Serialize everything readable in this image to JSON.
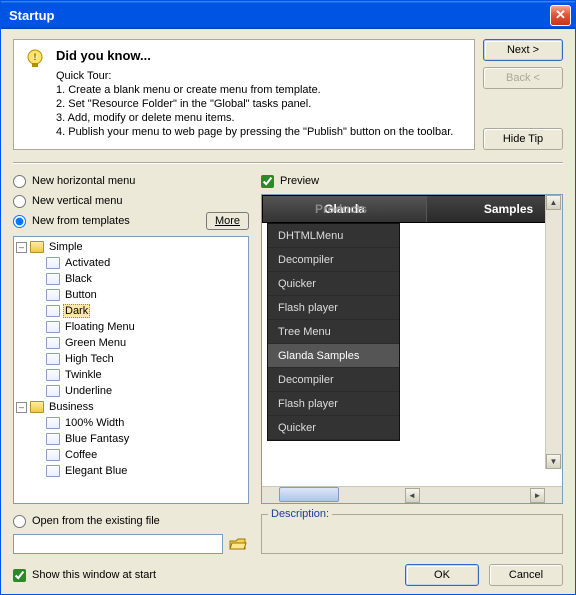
{
  "window": {
    "title": "Startup"
  },
  "tip": {
    "title": "Did you know...",
    "lines": [
      "Quick Tour:",
      "1. Create a blank menu or create menu from template.",
      "2. Set \"Resource Folder\" in the \"Global\" tasks panel.",
      "3. Add, modify or delete menu items.",
      "4. Publish your menu to web page by pressing the \"Publish\" button on the toolbar."
    ]
  },
  "buttons": {
    "next": "Next >",
    "back": "Back <",
    "hideTip": "Hide Tip",
    "more": "More",
    "ok": "OK",
    "cancel": "Cancel"
  },
  "radios": {
    "horizontal": "New horizontal menu",
    "vertical": "New vertical menu",
    "templates": "New from templates",
    "openExisting": "Open from the existing file"
  },
  "tree": {
    "group1": "Simple",
    "group1_items": [
      "Activated",
      "Black",
      "Button",
      "Dark",
      "Floating Menu",
      "Green Menu",
      "High Tech",
      "Twinkle",
      "Underline"
    ],
    "selected": "Dark",
    "group2": "Business",
    "group2_items": [
      "100% Width",
      "Blue Fantasy",
      "Coffee",
      "Elegant Blue"
    ]
  },
  "preview": {
    "label": "Preview",
    "tabs": [
      "Glanda",
      "Samples"
    ],
    "overlay": "Products",
    "submenu": [
      "DHTMLMenu",
      "Decompiler",
      "Quicker",
      "Flash player",
      "Tree Menu",
      "Glanda Samples",
      "Decompiler",
      "Flash player",
      "Quicker"
    ],
    "hoverIndex": 5
  },
  "description": {
    "label": "Description:"
  },
  "showAtStart": "Show this window at start"
}
